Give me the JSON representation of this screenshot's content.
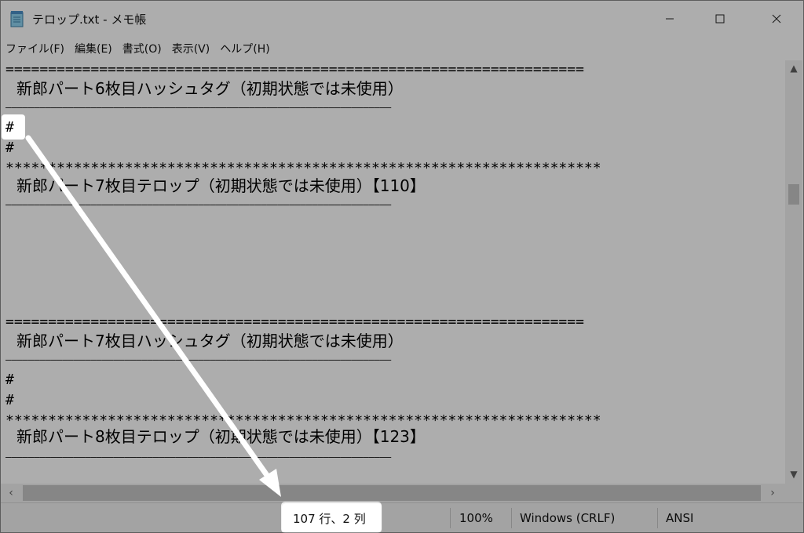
{
  "window": {
    "title": "テロップ.txt - メモ帳",
    "controls": {
      "minimize": "—",
      "maximize": "☐",
      "close": "✕"
    }
  },
  "menu": {
    "items": [
      "ファイル(F)",
      "編集(E)",
      "書式(O)",
      "表示(V)",
      "ヘルプ(H)"
    ]
  },
  "editor": {
    "lines": {
      "l1": "====================================================================",
      "l2": "新郎パート6枚目ハッシュタグ（初期状態では未使用）",
      "l3": "――――――――――――――――――――――――――――――――――――――――――――――――――――――――――――――――――――",
      "l4": "#",
      "l5": "#",
      "l6": "**********************************************************************",
      "l7": "新郎パート7枚目テロップ（初期状態では未使用）【110】",
      "l8": "――――――――――――――――――――――――――――――――――――――――――――――――――――――――――――――――――――",
      "l9": "====================================================================",
      "l10": "新郎パート7枚目ハッシュタグ（初期状態では未使用）",
      "l11": "――――――――――――――――――――――――――――――――――――――――――――――――――――――――――――――――――――",
      "l12": "#",
      "l13": "#",
      "l14": "**********************************************************************",
      "l15": "新郎パート8枚目テロップ（初期状態では未使用）【123】",
      "l16": "――――――――――――――――――――――――――――――――――――――――――――――――――――――――――――――――――――"
    }
  },
  "scrollbars": {
    "up": "▲",
    "down": "▼",
    "left": "‹",
    "right": "›"
  },
  "status": {
    "position": "107 行、2 列",
    "zoom": "100%",
    "line_ending": "Windows (CRLF)",
    "encoding": "ANSI"
  },
  "icons": {
    "app": "notepad-icon"
  }
}
